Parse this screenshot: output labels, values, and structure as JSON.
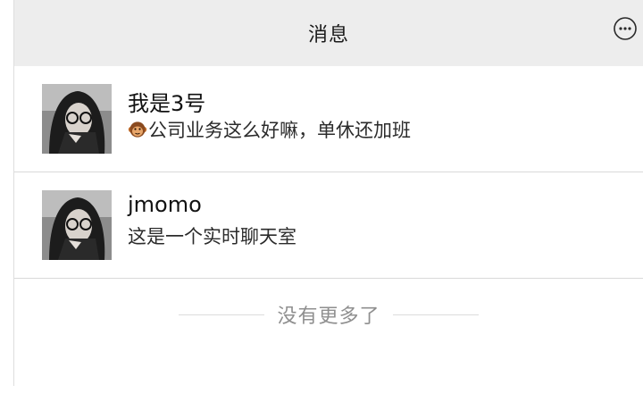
{
  "header": {
    "title": "消息",
    "more_icon": "more-horizontal-circle-icon"
  },
  "chats": [
    {
      "name": "我是3号",
      "message_emoji": "monkey-face-icon",
      "message": "公司业务这么好嘛，单休还加班"
    },
    {
      "name": "jmomo",
      "message": "这是一个实时聊天室"
    }
  ],
  "footer": {
    "no_more": "没有更多了"
  },
  "colors": {
    "header_bg": "#ededed",
    "divider": "#d9d9d9",
    "muted_text": "#8f8f8f"
  }
}
